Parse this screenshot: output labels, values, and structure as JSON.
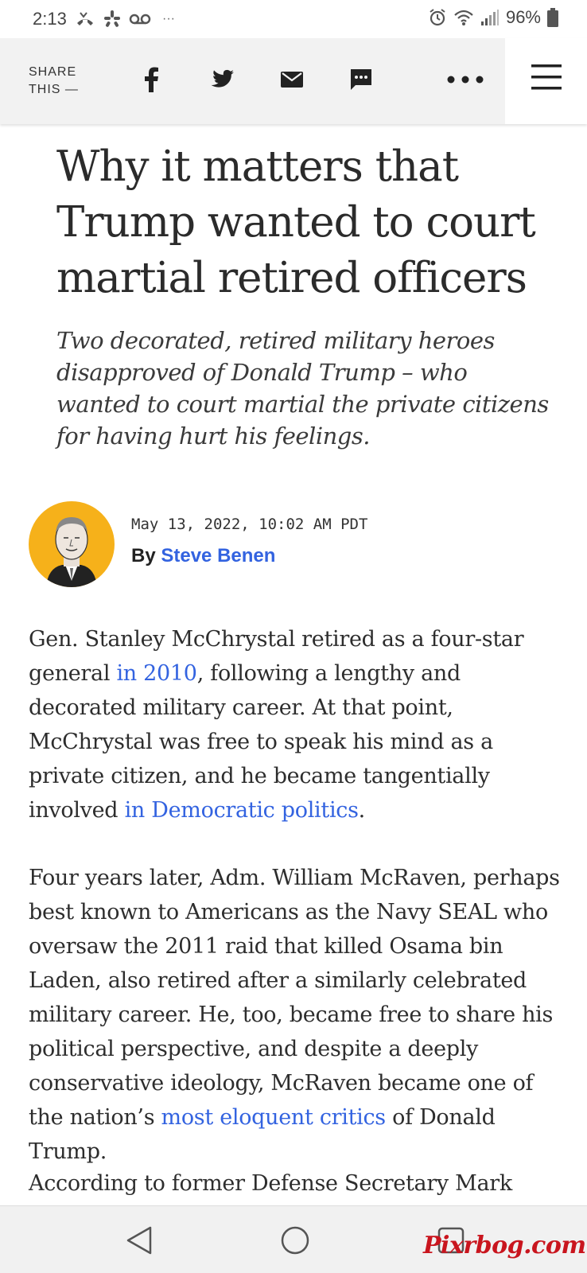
{
  "status_bar": {
    "time": "2:13",
    "overflow": "···",
    "battery": "96%",
    "left_icons": [
      "missed-call-icon",
      "yelp-icon",
      "voicemail-icon"
    ],
    "right_icons": [
      "alarm-icon",
      "wifi-icon",
      "signal-icon",
      "battery-icon"
    ]
  },
  "share_bar": {
    "label_line1": "SHARE",
    "label_line2": "THIS —",
    "icons": [
      "facebook-icon",
      "twitter-icon",
      "email-icon",
      "sms-icon",
      "more-icon"
    ],
    "menu_icon": "hamburger-menu-icon"
  },
  "article": {
    "headline": "Why it matters that Trump wanted to court martial retired officers",
    "dek": "Two decorated, retired military heroes disapproved of Donald Trump – who wanted to court martial the private citizens for having hurt his feelings.",
    "dateline": "May 13, 2022, 10:02 AM PDT",
    "by_prefix": "By",
    "author": "Steve Benen",
    "paragraphs": {
      "p1": {
        "t1": "Gen. Stanley McChrystal retired as a four-star general ",
        "link1": "in 2010",
        "t2": ", following a lengthy and decorated military career. At that point, McChrystal was free to speak his mind as a private citizen, and he became tangentially involved ",
        "link2": "in Democratic politics",
        "t3": "."
      },
      "p2": {
        "t1": "Four years later, Adm. William McRaven, perhaps best known to Americans as the Navy SEAL who oversaw the 2011 raid that killed Osama bin Laden, also retired after a similarly celebrated military career. He, too, became free to share his political perspective, and despite a deeply conservative ideology, McRaven became one of the nation’s ",
        "link1": "most eloquent critics",
        "t2": " of Donald Trump."
      },
      "p3": {
        "t1": "According to former Defense Secretary Mark"
      }
    }
  },
  "nav_bar": {
    "icons": [
      "back-icon",
      "home-icon",
      "recents-icon"
    ]
  },
  "watermark": "Pixrbog.com",
  "colors": {
    "link": "#3363e0",
    "share_bar_bg": "#f2f2f2",
    "avatar_bg": "#f6b11a",
    "watermark": "#c9151e"
  }
}
